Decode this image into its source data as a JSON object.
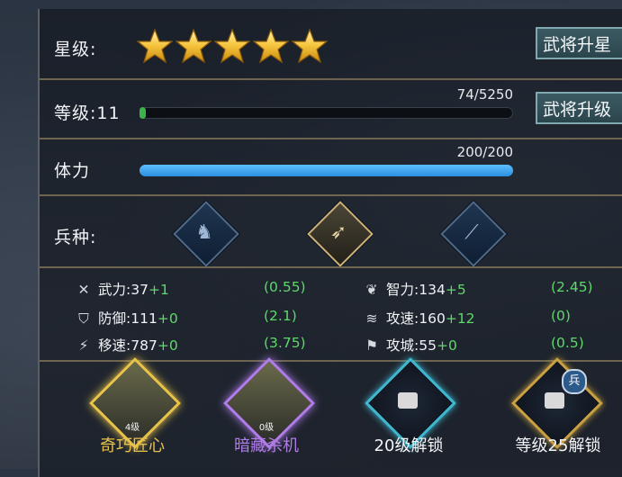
{
  "star_level": {
    "label": "星级:",
    "stars": 5,
    "button": "武将升星"
  },
  "level": {
    "label": "等级:11",
    "exp_text": "74/5250",
    "progress": 0.014,
    "button": "武将升级"
  },
  "stamina": {
    "label": "体力",
    "value_text": "200/200",
    "progress": 1.0
  },
  "troop_type": {
    "label": "兵种:",
    "items": [
      {
        "name": "cavalry",
        "icon": "horse-icon",
        "active": false
      },
      {
        "name": "archer",
        "icon": "bow-icon",
        "active": true
      },
      {
        "name": "spear",
        "icon": "spear-icon",
        "active": false
      }
    ]
  },
  "stats": {
    "left": [
      {
        "icon": "crossed-swords-icon",
        "label": "武力:",
        "base": "37",
        "bonus": "+1",
        "ratio": "(0.55)"
      },
      {
        "icon": "shield-icon",
        "label": "防御:",
        "base": "111",
        "bonus": "+0",
        "ratio": "(2.1)"
      },
      {
        "icon": "boot-icon",
        "label": "移速:",
        "base": "787",
        "bonus": "+0",
        "ratio": "(3.75)"
      }
    ],
    "right": [
      {
        "icon": "brain-icon",
        "label": "智力:",
        "base": "134",
        "bonus": "+5",
        "ratio": "(2.45)"
      },
      {
        "icon": "slash-icon",
        "label": "攻速:",
        "base": "160",
        "bonus": "+12",
        "ratio": "(0)"
      },
      {
        "icon": "flag-icon",
        "label": "攻城:",
        "base": "55",
        "bonus": "+0",
        "ratio": "(0.5)"
      }
    ]
  },
  "skills": [
    {
      "name": "奇巧匠心",
      "level": "4级",
      "color": "#e8c34a",
      "locked": false
    },
    {
      "name": "暗藏杀机",
      "level": "0级",
      "color": "#b07ce8",
      "locked": false
    },
    {
      "name": "20级解锁",
      "color": "#3fb7cf",
      "locked": true
    },
    {
      "name": "等级25解锁",
      "badge": "兵",
      "color": "#c9a040",
      "locked": true
    }
  ],
  "colors": {
    "gold": "#e8c34a",
    "exp_fill": "#3bb34a",
    "stamina_fill": "#3aa7f0",
    "bonus_green": "#5fd86a"
  }
}
